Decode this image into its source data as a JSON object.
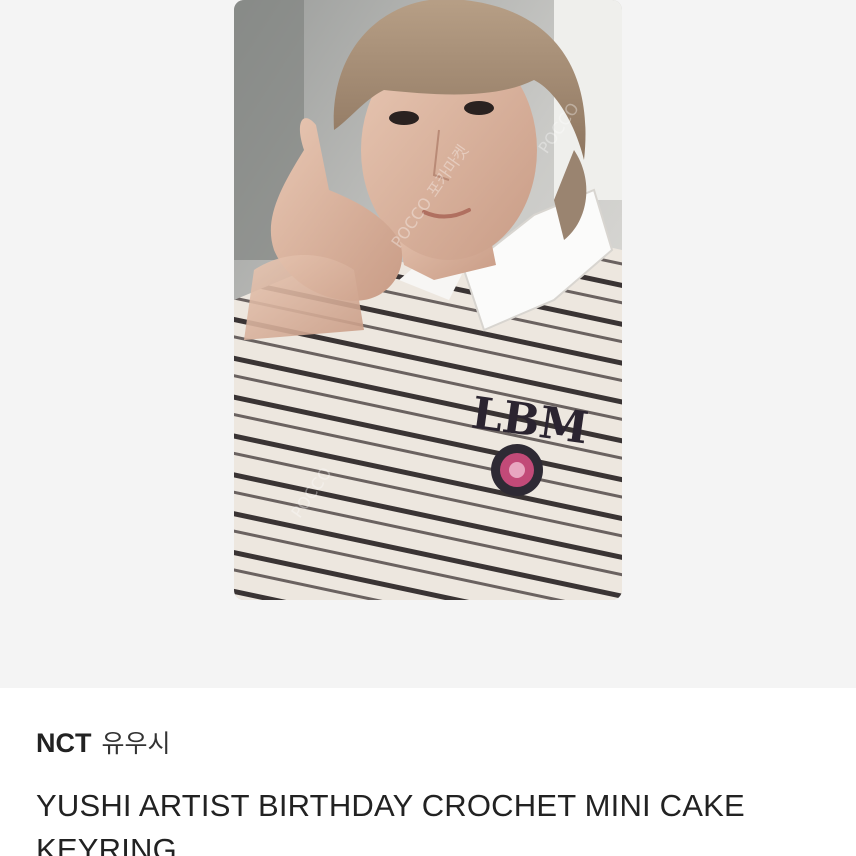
{
  "product": {
    "image_alt": "NCT Yushi photocard",
    "watermark": "POCCO 포카마켓",
    "artist_group": "NCT",
    "artist_member": "유우시",
    "title": "YUSHI ARTIST BIRTHDAY CROCHET MINI CAKE KEYRING",
    "shirt_logo": "LBM"
  },
  "colors": {
    "page_bg": "#ffffff",
    "image_bg": "#f4f4f4",
    "text": "#222222"
  }
}
